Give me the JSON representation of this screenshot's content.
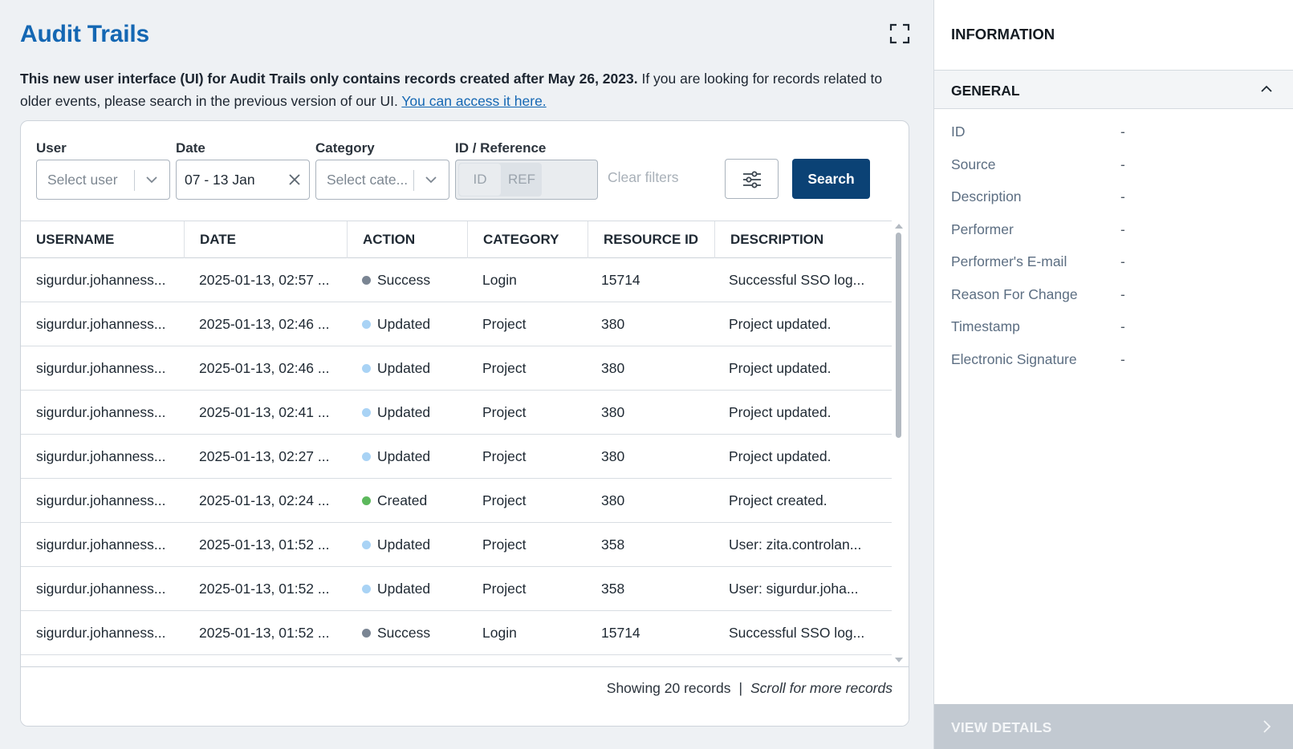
{
  "page": {
    "title": "Audit Trails",
    "notice_bold": "This new user interface (UI) for Audit Trails only contains records created after May 26, 2023.",
    "notice_rest": " If you are looking for records related to older events, please search in the previous version of our UI. ",
    "notice_link": "You can access it here."
  },
  "filters": {
    "user_label": "User",
    "user_placeholder": "Select user",
    "date_label": "Date",
    "date_value": "07 - 13 Jan",
    "category_label": "Category",
    "category_placeholder": "Select cate...",
    "idref_label": "ID / Reference",
    "id_option": "ID",
    "ref_option": "REF",
    "clear_filters": "Clear filters",
    "search_button": "Search"
  },
  "table": {
    "columns": [
      "USERNAME",
      "DATE",
      "ACTION",
      "CATEGORY",
      "RESOURCE ID",
      "DESCRIPTION"
    ],
    "rows": [
      {
        "username": "sigurdur.johanness...",
        "date": "2025-01-13, 02:57 ...",
        "action": "Success",
        "status": "success",
        "category": "Login",
        "resource_id": "15714",
        "description": "Successful SSO log..."
      },
      {
        "username": "sigurdur.johanness...",
        "date": "2025-01-13, 02:46 ...",
        "action": "Updated",
        "status": "updated",
        "category": "Project",
        "resource_id": "380",
        "description": "Project updated."
      },
      {
        "username": "sigurdur.johanness...",
        "date": "2025-01-13, 02:46 ...",
        "action": "Updated",
        "status": "updated",
        "category": "Project",
        "resource_id": "380",
        "description": "Project updated."
      },
      {
        "username": "sigurdur.johanness...",
        "date": "2025-01-13, 02:41 ...",
        "action": "Updated",
        "status": "updated",
        "category": "Project",
        "resource_id": "380",
        "description": "Project updated."
      },
      {
        "username": "sigurdur.johanness...",
        "date": "2025-01-13, 02:27 ...",
        "action": "Updated",
        "status": "updated",
        "category": "Project",
        "resource_id": "380",
        "description": "Project updated."
      },
      {
        "username": "sigurdur.johanness...",
        "date": "2025-01-13, 02:24 ...",
        "action": "Created",
        "status": "created",
        "category": "Project",
        "resource_id": "380",
        "description": "Project created."
      },
      {
        "username": "sigurdur.johanness...",
        "date": "2025-01-13, 01:52 ...",
        "action": "Updated",
        "status": "updated",
        "category": "Project",
        "resource_id": "358",
        "description": "User: zita.controlan..."
      },
      {
        "username": "sigurdur.johanness...",
        "date": "2025-01-13, 01:52 ...",
        "action": "Updated",
        "status": "updated",
        "category": "Project",
        "resource_id": "358",
        "description": "User: sigurdur.joha..."
      },
      {
        "username": "sigurdur.johanness...",
        "date": "2025-01-13, 01:52 ...",
        "action": "Success",
        "status": "success",
        "category": "Login",
        "resource_id": "15714",
        "description": "Successful SSO log..."
      }
    ],
    "status_colors": {
      "success": "#7a8593",
      "updated": "#a9d3f5",
      "created": "#5cb85c"
    }
  },
  "footer": {
    "showing": "Showing 20 records",
    "divider": "|",
    "scroll_hint": "Scroll for more records"
  },
  "panel": {
    "title": "INFORMATION",
    "section": "GENERAL",
    "fields": [
      {
        "key": "ID",
        "value": "-"
      },
      {
        "key": "Source",
        "value": "-"
      },
      {
        "key": "Description",
        "value": "-"
      },
      {
        "key": "Performer",
        "value": "-"
      },
      {
        "key": "Performer's E-mail",
        "value": "-"
      },
      {
        "key": "Reason For Change",
        "value": "-"
      },
      {
        "key": "Timestamp",
        "value": "-"
      },
      {
        "key": "Electronic Signature",
        "value": "-"
      }
    ],
    "view_details": "VIEW DETAILS"
  },
  "colors": {
    "brand": "#1467b3",
    "primary_button": "#0b4275"
  }
}
